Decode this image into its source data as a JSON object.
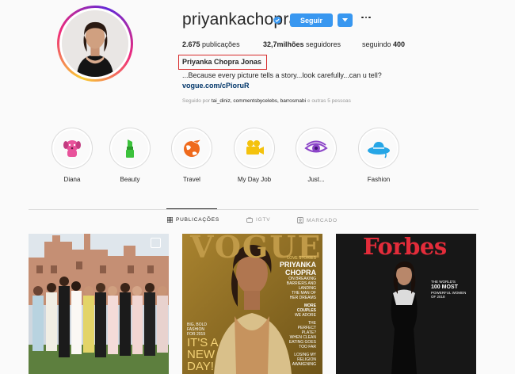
{
  "profile": {
    "username": "priyankachopra",
    "follow_label": "Seguir",
    "full_name": "Priyanka Chopra Jonas",
    "bio": "...Because every picture tells a story...look carefully...can u tell?",
    "link": "vogue.com/cPioruR"
  },
  "stats": {
    "posts_count": "2.675",
    "posts_label": " publicações",
    "followers_count": "32,7milhões",
    "followers_label": " seguidores",
    "following_label": "seguindo ",
    "following_count": "400"
  },
  "followed_by": {
    "prefix": "Seguido por ",
    "names": "tai_diniz, commentsbycelebs, barrosmabi",
    "suffix": " e outras 5 pessoas"
  },
  "highlights": [
    {
      "label": "Diana",
      "icon": "dog-icon",
      "color": "#e8539b"
    },
    {
      "label": "Beauty",
      "icon": "lipstick-icon",
      "color": "#3cc23c"
    },
    {
      "label": "Travel",
      "icon": "globe-plane-icon",
      "color": "#ef6a1c"
    },
    {
      "label": "My Day Job",
      "icon": "movie-camera-icon",
      "color": "#f4c20d"
    },
    {
      "label": "Just...",
      "icon": "eye-icon",
      "color": "#8b44c8"
    },
    {
      "label": "Fashion",
      "icon": "sun-hat-icon",
      "color": "#26a6e6"
    }
  ],
  "tabs": [
    {
      "label": "PUBLICAÇÕES",
      "icon": "grid-icon",
      "active": true
    },
    {
      "label": "IGTV",
      "icon": "tv-icon",
      "active": false
    },
    {
      "label": "MARCADO",
      "icon": "tag-icon",
      "active": false
    }
  ],
  "posts": [
    {
      "name": "wedding-photo",
      "description": "group photo"
    },
    {
      "name": "vogue-cover",
      "masthead": "VOGUE",
      "lines": [
        "LOVE STORIES",
        "PRIYANKA",
        "CHOPRA",
        "ON BREAKING",
        "BARRIERS AND",
        "LANDING",
        "THE MAN OF",
        "HER DREAMS",
        "MORE",
        "COUPLES",
        "WE ADORE",
        "THE",
        "PERFECT",
        "PLATE?",
        "WHEN CLEAN",
        "EATING GOES",
        "TOO FAR",
        "LOSING MY",
        "RELIGION",
        "AWAKENING"
      ],
      "left_lines": [
        "BIG, BOLD",
        "FASHION",
        "FOR 2019",
        "IT'S A",
        "NEW",
        "DAY!"
      ]
    },
    {
      "name": "forbes-cover",
      "masthead": "Forbes",
      "lines": [
        "THE WORLD'S",
        "100 MOST",
        "POWERFUL WOMEN",
        "OF 2018"
      ]
    }
  ],
  "colors": {
    "accent": "#3897f0",
    "highlight_box": "#d62a2a"
  }
}
